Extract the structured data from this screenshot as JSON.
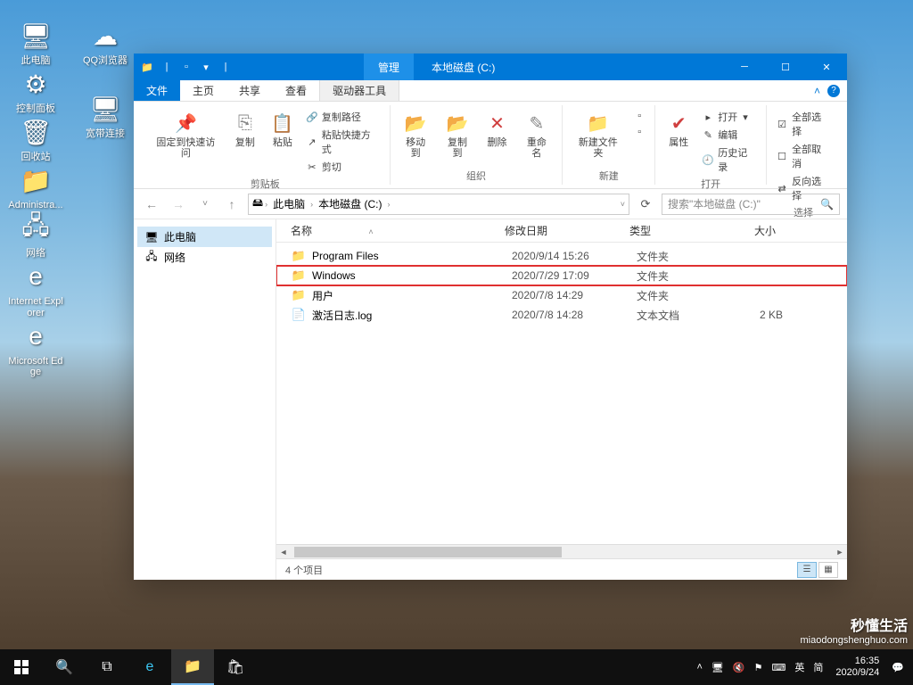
{
  "desktop_icons_col1": [
    {
      "label": "此电脑",
      "name": "this-pc-icon"
    },
    {
      "label": "控制面板",
      "name": "control-panel-icon"
    },
    {
      "label": "回收站",
      "name": "recycle-bin-icon"
    },
    {
      "label": "Administra...",
      "name": "user-folder-icon"
    },
    {
      "label": "网络",
      "name": "network-icon"
    },
    {
      "label": "Internet Explorer",
      "name": "ie-icon"
    },
    {
      "label": "Microsoft Edge",
      "name": "edge-icon"
    }
  ],
  "desktop_icons_col2": [
    {
      "label": "QQ浏览器",
      "name": "qq-browser-icon"
    },
    {
      "label": "宽带连接",
      "name": "broadband-icon"
    }
  ],
  "window": {
    "context_tab": "管理",
    "title": "本地磁盘 (C:)",
    "tabs": {
      "file": "文件",
      "home": "主页",
      "share": "共享",
      "view": "查看",
      "drive": "驱动器工具"
    }
  },
  "ribbon": {
    "clipboard": {
      "pin": "固定到快速访问",
      "copy": "复制",
      "paste": "粘贴",
      "copy_path": "复制路径",
      "paste_shortcut": "粘贴快捷方式",
      "cut": "剪切",
      "label": "剪贴板"
    },
    "organize": {
      "move": "移动到",
      "copy_to": "复制到",
      "delete": "删除",
      "rename": "重命名",
      "label": "组织"
    },
    "new": {
      "folder": "新建文件夹",
      "label": "新建"
    },
    "open": {
      "props": "属性",
      "open": "打开",
      "edit": "编辑",
      "history": "历史记录",
      "label": "打开"
    },
    "select": {
      "all": "全部选择",
      "none": "全部取消",
      "invert": "反向选择",
      "label": "选择"
    }
  },
  "breadcrumb": [
    "此电脑",
    "本地磁盘 (C:)"
  ],
  "search_placeholder": "搜索\"本地磁盘 (C:)\"",
  "nav_items": [
    {
      "label": "此电脑",
      "name": "nav-this-pc",
      "selected": true
    },
    {
      "label": "网络",
      "name": "nav-network",
      "selected": false
    }
  ],
  "columns": {
    "name": "名称",
    "date": "修改日期",
    "type": "类型",
    "size": "大小"
  },
  "files": [
    {
      "name": "Program Files",
      "date": "2020/9/14 15:26",
      "type": "文件夹",
      "size": "",
      "icon": "folder",
      "hl": false
    },
    {
      "name": "Windows",
      "date": "2020/7/29 17:09",
      "type": "文件夹",
      "size": "",
      "icon": "folder",
      "hl": true
    },
    {
      "name": "用户",
      "date": "2020/7/8 14:29",
      "type": "文件夹",
      "size": "",
      "icon": "folder",
      "hl": false
    },
    {
      "name": "激活日志.log",
      "date": "2020/7/8 14:28",
      "type": "文本文档",
      "size": "2 KB",
      "icon": "file",
      "hl": false
    }
  ],
  "status": "4 个项目",
  "taskbar_time": "16:35",
  "taskbar_date": "2020/9/24",
  "ime": {
    "lang1": "英",
    "lang2": "简"
  },
  "watermark": {
    "line1": "秒懂生活",
    "line2": "miaodongshenghuo.com"
  }
}
